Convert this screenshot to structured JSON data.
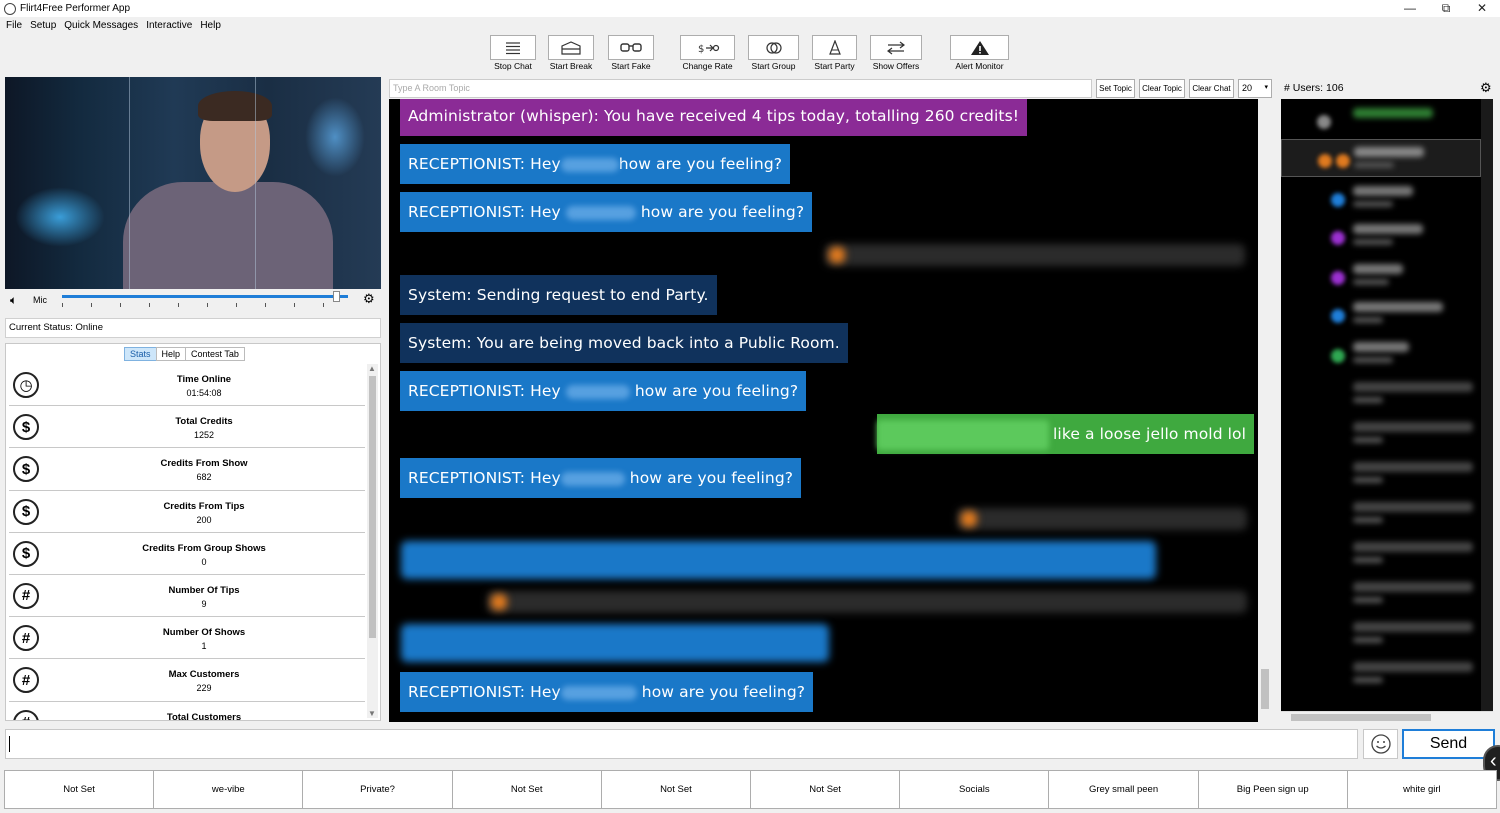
{
  "window": {
    "title": "Flirt4Free Performer App",
    "minimize": "—",
    "maximize": "⧉",
    "close": "✕"
  },
  "menu": [
    "File",
    "Setup",
    "Quick Messages",
    "Interactive",
    "Help"
  ],
  "toolbar": [
    {
      "label": "Stop Chat",
      "icon": "list-icon"
    },
    {
      "label": "Start Break",
      "icon": "bed-icon"
    },
    {
      "label": "Start Fake",
      "icon": "glasses-icon"
    },
    {
      "label": "Change Rate",
      "icon": "rate-icon"
    },
    {
      "label": "Start Group",
      "icon": "group-icon"
    },
    {
      "label": "Start Party",
      "icon": "party-hat-icon"
    },
    {
      "label": "Show Offers",
      "icon": "swap-arrows-icon"
    },
    {
      "label": "Alert Monitor",
      "icon": "warning-icon"
    }
  ],
  "video": {
    "mic_label": "Mic",
    "mic_level": 0.96
  },
  "status": {
    "text": "Current Status: Online"
  },
  "tabs": [
    {
      "label": "Stats",
      "active": true
    },
    {
      "label": "Help",
      "active": false
    },
    {
      "label": "Contest Tab",
      "active": false
    }
  ],
  "stats": [
    {
      "label": "Time Online",
      "value": "01:54:08",
      "icon": "clock-icon",
      "glyph": "◷"
    },
    {
      "label": "Total Credits",
      "value": "1252",
      "icon": "dollar-icon",
      "glyph": "$"
    },
    {
      "label": "Credits From Show",
      "value": "682",
      "icon": "dollar-icon",
      "glyph": "$"
    },
    {
      "label": "Credits From Tips",
      "value": "200",
      "icon": "dollar-icon",
      "glyph": "$"
    },
    {
      "label": "Credits From Group Shows",
      "value": "0",
      "icon": "dollar-icon",
      "glyph": "$"
    },
    {
      "label": "Number Of Tips",
      "value": "9",
      "icon": "hash-icon",
      "glyph": "#"
    },
    {
      "label": "Number Of Shows",
      "value": "1",
      "icon": "hash-icon",
      "glyph": "#"
    },
    {
      "label": "Max Customers",
      "value": "229",
      "icon": "hash-icon",
      "glyph": "#"
    },
    {
      "label": "Total Customers",
      "value": "",
      "icon": "hash-icon",
      "glyph": "#"
    }
  ],
  "topic": {
    "placeholder": "Type A Room Topic",
    "set_topic": "Set Topic",
    "clear_topic": "Clear Topic",
    "clear_chat": "Clear Chat",
    "font_size": "20"
  },
  "chat": {
    "admin_msg": "Administrator (whisper): You have received 4 tips today, totalling 260 credits!",
    "rec_prefix": "RECEPTIONIST: Hey",
    "rec_suffix": "how are you feeling?",
    "sys_msg_1": "System: Sending request to end Party.",
    "sys_msg_2": "System: You are being moved back into a Public Room.",
    "own_msg": "like a loose jello mold lol"
  },
  "users": {
    "count_label": "# Users: 106"
  },
  "input": {
    "send_label": "Send"
  },
  "quick_messages": [
    "Not Set",
    "we-vibe",
    "Private?",
    "Not Set",
    "Not Set",
    "Not Set",
    "Socials",
    "Grey small peen",
    "Big Peen sign up",
    "white girl"
  ],
  "colors": {
    "accent": "#1f7ed8",
    "bubble_blue": "#1a78c8",
    "bubble_navy": "#10325c",
    "bubble_purple": "#8b2b96",
    "bubble_green": "#3fa93f"
  }
}
